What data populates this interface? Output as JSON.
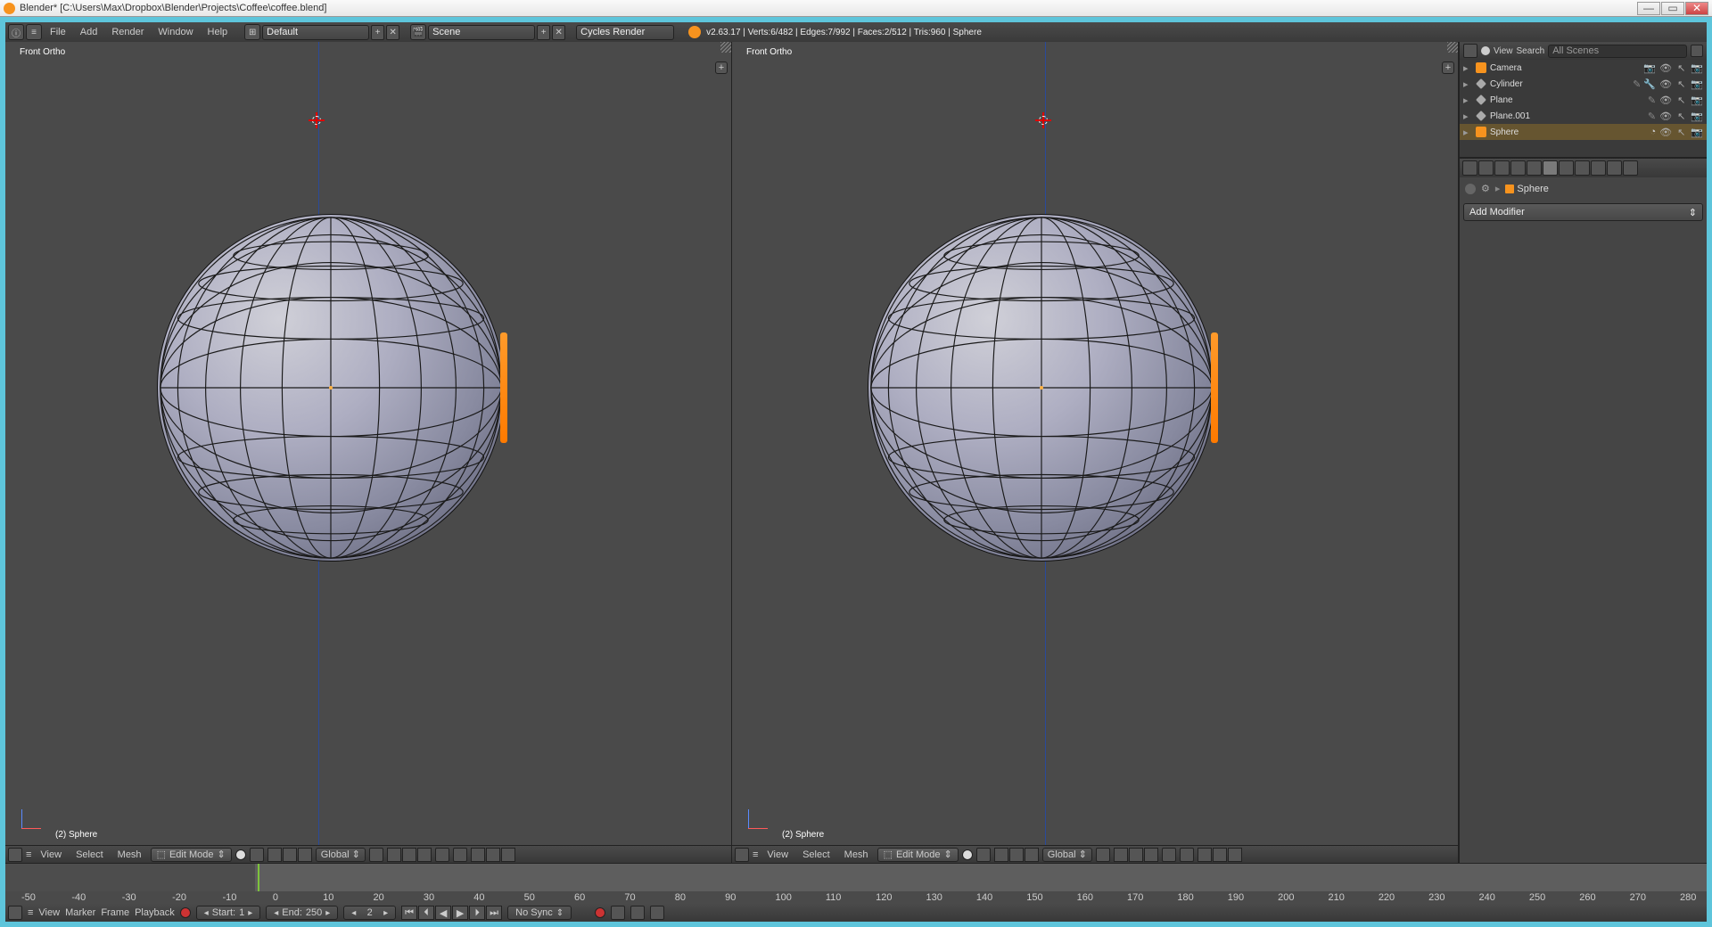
{
  "window": {
    "title": "Blender* [C:\\Users\\Max\\Dropbox\\Blender\\Projects\\Coffee\\coffee.blend]"
  },
  "menubar": {
    "file": "File",
    "add": "Add",
    "render": "Render",
    "window": "Window",
    "help": "Help",
    "layout": "Default",
    "scene": "Scene",
    "engine": "Cycles Render",
    "stats": "v2.63.17 | Verts:6/482 | Edges:7/992 | Faces:2/512 | Tris:960 | Sphere"
  },
  "viewport": {
    "label": "Front Ortho",
    "objlabel": "(2) Sphere"
  },
  "vphdr": {
    "view": "View",
    "select": "Select",
    "mesh": "Mesh",
    "mode": "Edit Mode",
    "orient": "Global"
  },
  "outliner": {
    "view": "View",
    "search": "Search",
    "filter": "All Scenes",
    "items": [
      {
        "name": "Camera"
      },
      {
        "name": "Cylinder"
      },
      {
        "name": "Plane"
      },
      {
        "name": "Plane.001"
      },
      {
        "name": "Sphere"
      }
    ]
  },
  "props": {
    "obj": "Sphere",
    "addmod": "Add Modifier"
  },
  "timeline": {
    "view": "View",
    "marker": "Marker",
    "frame": "Frame",
    "playback": "Playback",
    "start_lbl": "Start:",
    "start": "1",
    "end_lbl": "End:",
    "end": "250",
    "current": "2",
    "sync": "No Sync",
    "ticks": [
      "-50",
      "-40",
      "-30",
      "-20",
      "-10",
      "0",
      "10",
      "20",
      "30",
      "40",
      "50",
      "60",
      "70",
      "80",
      "90",
      "100",
      "110",
      "120",
      "130",
      "140",
      "150",
      "160",
      "170",
      "180",
      "190",
      "200",
      "210",
      "220",
      "230",
      "240",
      "250",
      "260",
      "270",
      "280"
    ]
  }
}
